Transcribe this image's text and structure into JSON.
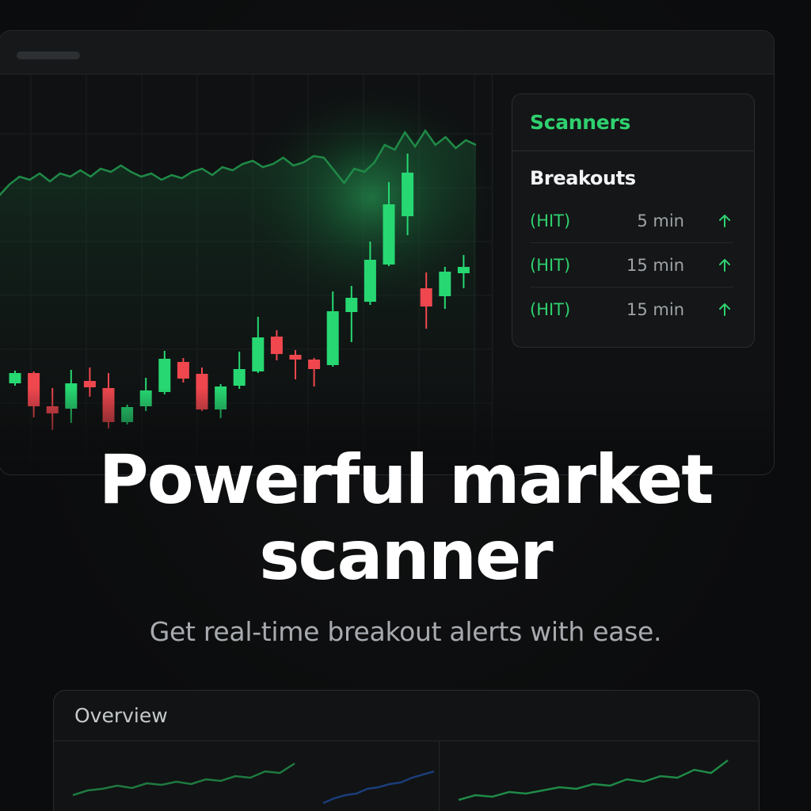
{
  "hero": {
    "title_line1": "Powerful market",
    "title_line2": "scanner",
    "subtitle": "Get real-time breakout alerts with ease."
  },
  "scanner_panel": {
    "title": "Scanners",
    "section_title": "Breakouts",
    "rows": [
      {
        "status": "(HIT)",
        "interval": "5 min",
        "icon": "arrow-up-icon"
      },
      {
        "status": "(HIT)",
        "interval": "15 min",
        "icon": "arrow-up-icon"
      },
      {
        "status": "(HIT)",
        "interval": "15 min",
        "icon": "arrow-up-icon"
      }
    ]
  },
  "overview_panel": {
    "title": "Overview"
  },
  "colors": {
    "accent_green": "#2fd16f",
    "bull_candle": "#27d872",
    "bear_candle": "#f0474e",
    "background": "#0b0c0d"
  },
  "chart_data": {
    "type": "candlestick",
    "candles": [
      {
        "o": 445,
        "c": 432,
        "h": 429,
        "l": 448
      },
      {
        "o": 432,
        "c": 474,
        "h": 430,
        "l": 488
      },
      {
        "o": 474,
        "c": 483,
        "h": 451,
        "l": 504
      },
      {
        "o": 477,
        "c": 445,
        "h": 428,
        "l": 495
      },
      {
        "o": 442,
        "c": 450,
        "h": 425,
        "l": 462
      },
      {
        "o": 451,
        "c": 494,
        "h": 432,
        "l": 502
      },
      {
        "o": 494,
        "c": 475,
        "h": 472,
        "l": 497
      },
      {
        "o": 474,
        "c": 454,
        "h": 438,
        "l": 480
      },
      {
        "o": 456,
        "c": 414,
        "h": 404,
        "l": 459
      },
      {
        "o": 418,
        "c": 439,
        "h": 413,
        "l": 444
      },
      {
        "o": 433,
        "c": 478,
        "h": 425,
        "l": 480
      },
      {
        "o": 478,
        "c": 449,
        "h": 446,
        "l": 489
      },
      {
        "o": 448,
        "c": 427,
        "h": 405,
        "l": 452
      },
      {
        "o": 430,
        "c": 387,
        "h": 361,
        "l": 432
      },
      {
        "o": 386,
        "c": 408,
        "h": 378,
        "l": 416
      },
      {
        "o": 409,
        "c": 415,
        "h": 403,
        "l": 440
      },
      {
        "o": 415,
        "c": 427,
        "h": 413,
        "l": 449
      },
      {
        "o": 422,
        "c": 354,
        "h": 329,
        "l": 424
      },
      {
        "o": 355,
        "c": 337,
        "h": 322,
        "l": 393
      },
      {
        "o": 342,
        "c": 289,
        "h": 266,
        "l": 346
      },
      {
        "o": 295,
        "c": 219,
        "h": 191,
        "l": 297
      },
      {
        "o": 234,
        "c": 179,
        "h": 155,
        "l": 258
      },
      {
        "o": 325,
        "c": 348,
        "h": 305,
        "l": 376
      },
      {
        "o": 335,
        "c": 304,
        "h": 298,
        "l": 351
      },
      {
        "o": 306,
        "c": 298,
        "h": 283,
        "l": 325
      }
    ],
    "overlay_line": [
      208,
      194,
      184,
      188,
      180,
      190,
      180,
      184,
      176,
      184,
      174,
      178,
      170,
      178,
      184,
      180,
      188,
      182,
      186,
      178,
      174,
      182,
      172,
      176,
      168,
      164,
      172,
      168,
      160,
      170,
      166,
      158,
      160,
      176,
      192,
      174,
      178,
      166,
      144,
      150,
      128,
      146,
      126,
      144,
      134,
      148,
      138,
      144
    ],
    "ylim": [
      120,
      520
    ]
  },
  "mini_charts": [
    {
      "series_a": [
        50,
        44,
        42,
        38,
        41,
        35,
        37,
        33,
        36,
        30,
        32,
        26,
        28,
        20,
        22,
        10
      ]
    },
    {
      "series_a": [
        56,
        50,
        52,
        46,
        48,
        44,
        40,
        42,
        36,
        38,
        30,
        33,
        26,
        28,
        18,
        22,
        6
      ],
      "series_b": [
        60,
        54,
        50,
        48,
        42,
        40,
        36,
        34,
        28,
        24,
        20
      ]
    }
  ]
}
